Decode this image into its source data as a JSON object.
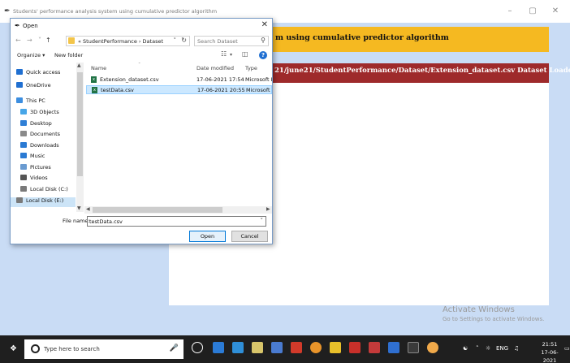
{
  "app": {
    "title": "Students' performance analysis system using cumulative predictor algorithm",
    "banner_text": "m using cumulative predictor algorithm",
    "status_text": "21/june21/StudentPerformance/Dataset/Extension_dataset.csv Dataset Loaded",
    "minimize": "–",
    "maximize": "▢",
    "close": "✕"
  },
  "dialog": {
    "title": "Open",
    "close": "✕",
    "back": "←",
    "forward": "→",
    "up": "↑",
    "breadcrumb": "« StudentPerformance › Dataset",
    "search_placeholder": "Search Dataset",
    "organize_label": "Organize ▾",
    "new_folder_label": "New folder",
    "nav_items": [
      {
        "label": "Quick access",
        "icon": "star-icon",
        "color": "#1f6fd1"
      },
      {
        "label": "OneDrive",
        "icon": "cloud-icon",
        "color": "#1f6fd1"
      },
      {
        "label": "This PC",
        "icon": "computer-icon",
        "color": "#3c8ee0"
      },
      {
        "label": "3D Objects",
        "icon": "cube-icon",
        "color": "#47a6e8"
      },
      {
        "label": "Desktop",
        "icon": "desktop-icon",
        "color": "#2f7fd6"
      },
      {
        "label": "Documents",
        "icon": "document-icon",
        "color": "#8a8a8a"
      },
      {
        "label": "Downloads",
        "icon": "download-icon",
        "color": "#2a7ad3"
      },
      {
        "label": "Music",
        "icon": "music-icon",
        "color": "#2a7ad3"
      },
      {
        "label": "Pictures",
        "icon": "pictures-icon",
        "color": "#6a9bd1"
      },
      {
        "label": "Videos",
        "icon": "video-icon",
        "color": "#555555"
      },
      {
        "label": "Local Disk (C:)",
        "icon": "drive-icon",
        "color": "#7a7a7a"
      },
      {
        "label": "Local Disk (E:)",
        "icon": "drive-icon",
        "color": "#7a7a7a"
      }
    ],
    "columns": [
      "Name",
      "Date modified",
      "Type"
    ],
    "files": [
      {
        "name": "Extension_dataset.csv",
        "date": "17-06-2021 17:54",
        "type": "Microsoft Excel C"
      },
      {
        "name": "testData.csv",
        "date": "17-06-2021 20:55",
        "type": "Microsoft Excel C"
      }
    ],
    "selected_file_index": 1,
    "file_name_label": "File name:",
    "file_name_value": "testData.csv",
    "open_button": "Open",
    "cancel_button": "Cancel"
  },
  "watermark": {
    "line1": "Activate Windows",
    "line2": "Go to Settings to activate Windows."
  },
  "taskbar": {
    "search_placeholder": "Type here to search",
    "time": "21:51",
    "date": "17-06-2021",
    "tray_text": "ENG"
  },
  "colors": {
    "banner": "#f5b921",
    "status": "#9e2a2b",
    "background": "#c9dcf5",
    "selection": "#cce8ff"
  }
}
